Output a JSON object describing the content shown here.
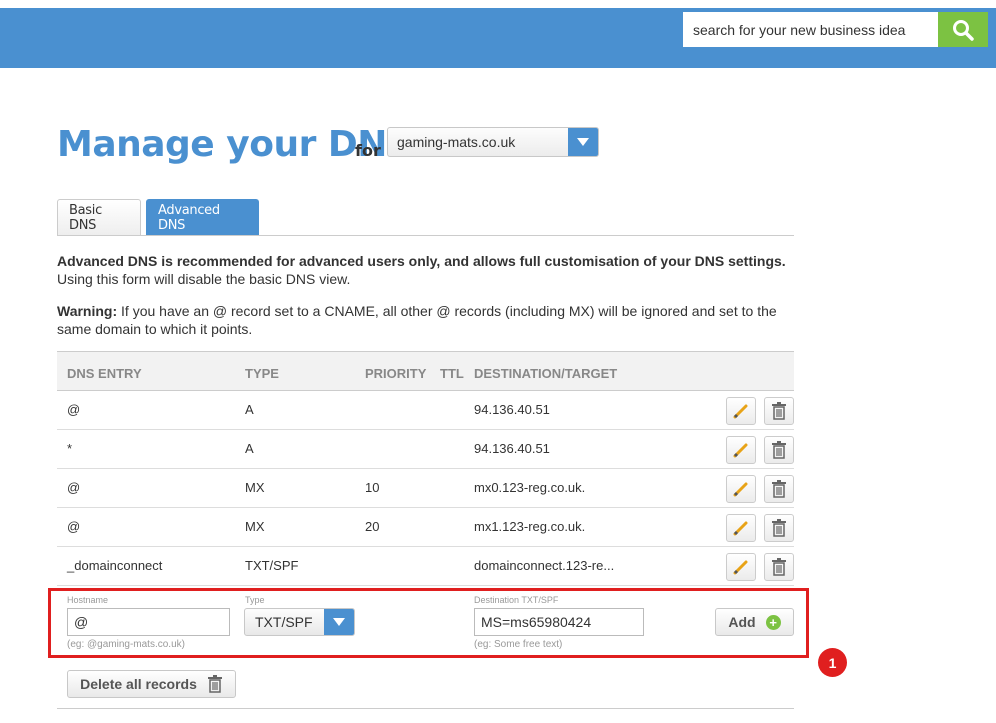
{
  "header": {
    "search_placeholder": "search for your new business idea",
    "search_button_icon": "search-icon",
    "bg_color": "#4a90d0",
    "accent_color": "#7cc242"
  },
  "title": {
    "main": "Manage your DNS",
    "for_label": "for",
    "domain_selected": "gaming-mats.co.uk"
  },
  "tabs": [
    {
      "label": "Basic DNS",
      "active": false
    },
    {
      "label": "Advanced DNS",
      "active": true
    }
  ],
  "intro": {
    "bold": "Advanced DNS is recommended for advanced users only, and allows full customisation of your DNS settings.",
    "normal": "Using this form will disable the basic DNS view."
  },
  "warning": {
    "label": "Warning:",
    "text": " If you have an @ record set to a CNAME, all other @ records (including MX) will be ignored and set to the same domain to which it points."
  },
  "table": {
    "headers": {
      "entry": "DNS ENTRY",
      "type": "TYPE",
      "priority": "PRIORITY",
      "ttl": "TTL",
      "dest": "DESTINATION/TARGET"
    },
    "rows": [
      {
        "entry": "@",
        "type": "A",
        "priority": "",
        "ttl": "",
        "dest": "94.136.40.51"
      },
      {
        "entry": "*",
        "type": "A",
        "priority": "",
        "ttl": "",
        "dest": "94.136.40.51"
      },
      {
        "entry": "@",
        "type": "MX",
        "priority": "10",
        "ttl": "",
        "dest": "mx0.123-reg.co.uk."
      },
      {
        "entry": "@",
        "type": "MX",
        "priority": "20",
        "ttl": "",
        "dest": "mx1.123-reg.co.uk."
      },
      {
        "entry": "_domainconnect",
        "type": "TXT/SPF",
        "priority": "",
        "ttl": "",
        "dest": "domainconnect.123-re..."
      }
    ],
    "edit_icon": "pencil-icon",
    "delete_icon": "trash-icon"
  },
  "add_form": {
    "hostname_label": "Hostname",
    "hostname_value": "@",
    "hostname_hint": "(eg: @gaming-mats.co.uk)",
    "type_label": "Type",
    "type_value": "TXT/SPF",
    "dest_label": "Destination TXT/SPF",
    "dest_value": "MS=ms65980424",
    "dest_hint": "(eg: Some free text)",
    "add_label": "Add"
  },
  "annotation": {
    "badge": "1",
    "color": "#e01f1f"
  },
  "delete_all_label": "Delete all records"
}
